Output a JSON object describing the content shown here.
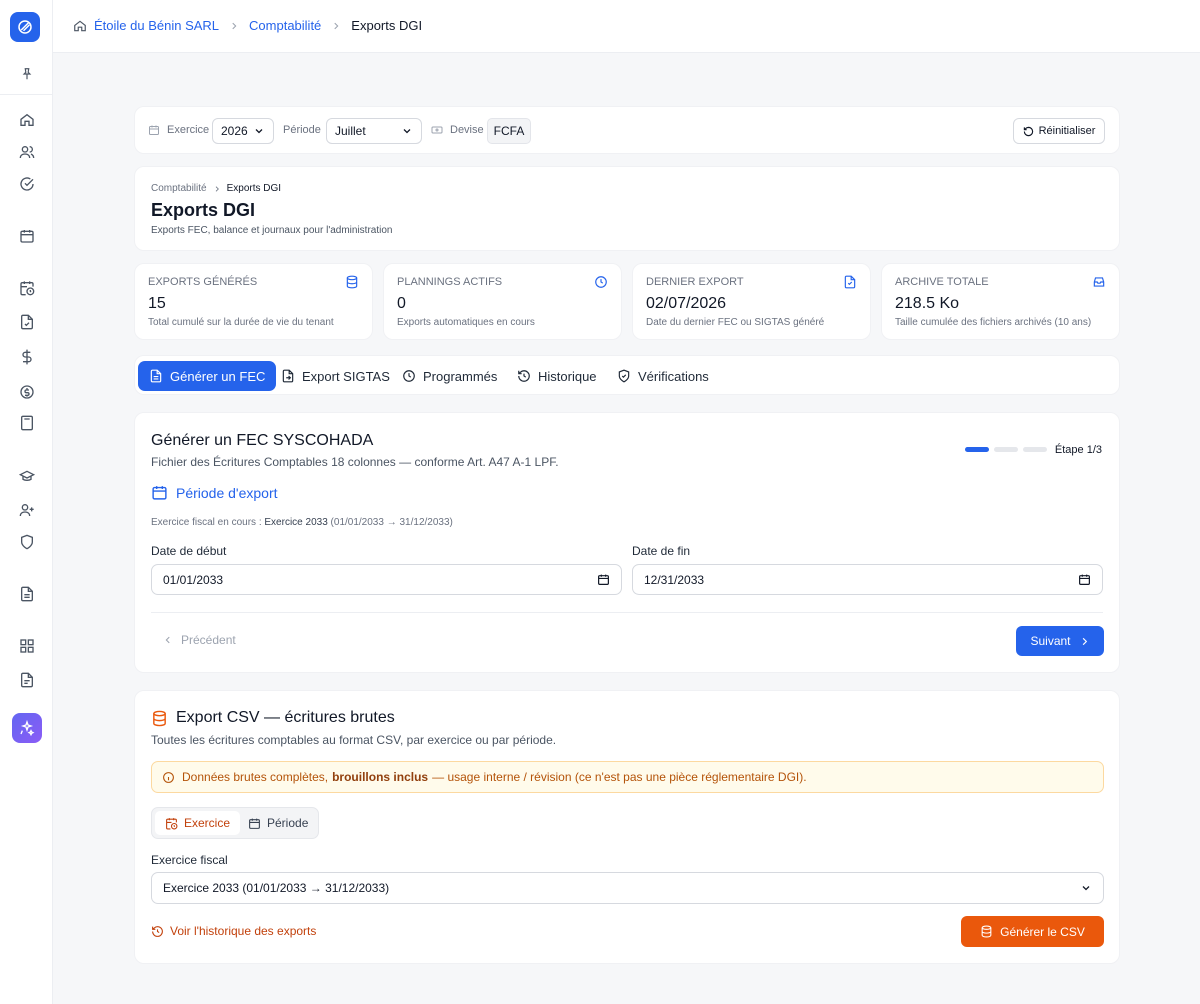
{
  "breadcrumb": {
    "company": "Étoile du Bénin SARL",
    "section": "Comptabilité",
    "current": "Exports DGI"
  },
  "filters": {
    "exercice_label": "Exercice",
    "exercice_value": "2026",
    "periode_label": "Période",
    "periode_value": "Juillet",
    "devise_label": "Devise",
    "devise_value": "FCFA",
    "reset_label": "Réinitialiser"
  },
  "header": {
    "crumb_parent": "Comptabilité",
    "crumb_current": "Exports DGI",
    "title": "Exports DGI",
    "subtitle": "Exports FEC, balance et journaux pour l'administration"
  },
  "stats": [
    {
      "label": "Exports générés",
      "value": "15",
      "desc": "Total cumulé sur la durée de vie du tenant",
      "icon": "database-icon"
    },
    {
      "label": "Plannings actifs",
      "value": "0",
      "desc": "Exports automatiques en cours",
      "icon": "clock-icon"
    },
    {
      "label": "Dernier export",
      "value": "02/07/2026",
      "desc": "Date du dernier FEC ou SIGTAS généré",
      "icon": "file-icon"
    },
    {
      "label": "Archive totale",
      "value": "218.5 Ko",
      "desc": "Taille cumulée des fichiers archivés (10 ans)",
      "icon": "archive-icon"
    }
  ],
  "tabs": [
    {
      "label": "Générer un FEC",
      "active": true
    },
    {
      "label": "Export SIGTAS",
      "active": false
    },
    {
      "label": "Programmés",
      "active": false
    },
    {
      "label": "Historique",
      "active": false
    },
    {
      "label": "Vérifications",
      "active": false
    }
  ],
  "fec": {
    "title": "Générer un FEC SYSCOHADA",
    "subtitle": "Fichier des Écritures Comptables 18 colonnes — conforme Art. A47 A-1 LPF.",
    "step_label": "Étape 1/3",
    "current_step": 1,
    "total_steps": 3,
    "section_title": "Période d'export",
    "fy_prefix": "Exercice fiscal en cours :",
    "fy_name": "Exercice 2033",
    "fy_range": "(01/01/2033 → 31/12/2033)",
    "start_label": "Date de début",
    "start_value": "01/01/2033",
    "end_label": "Date de fin",
    "end_value": "12/31/2033",
    "prev_label": "Précédent",
    "next_label": "Suivant"
  },
  "csv": {
    "title": "Export CSV — écritures brutes",
    "subtitle": "Toutes les écritures comptables au format CSV, par exercice ou par période.",
    "warn_start": "Données brutes complètes,",
    "warn_bold": "brouillons inclus",
    "warn_end": "— usage interne / révision (ce n'est pas une pièce réglementaire DGI).",
    "mode_exercice": "Exercice",
    "mode_periode": "Période",
    "fy_label": "Exercice fiscal",
    "fy_value": "Exercice 2033 (01/01/2033 → 31/12/2033)",
    "history_link": "Voir l'historique des exports",
    "generate_label": "Générer le CSV"
  },
  "colors": {
    "primary": "#2563eb",
    "orange": "#ea580c",
    "warning_bg": "#fffbeb"
  }
}
